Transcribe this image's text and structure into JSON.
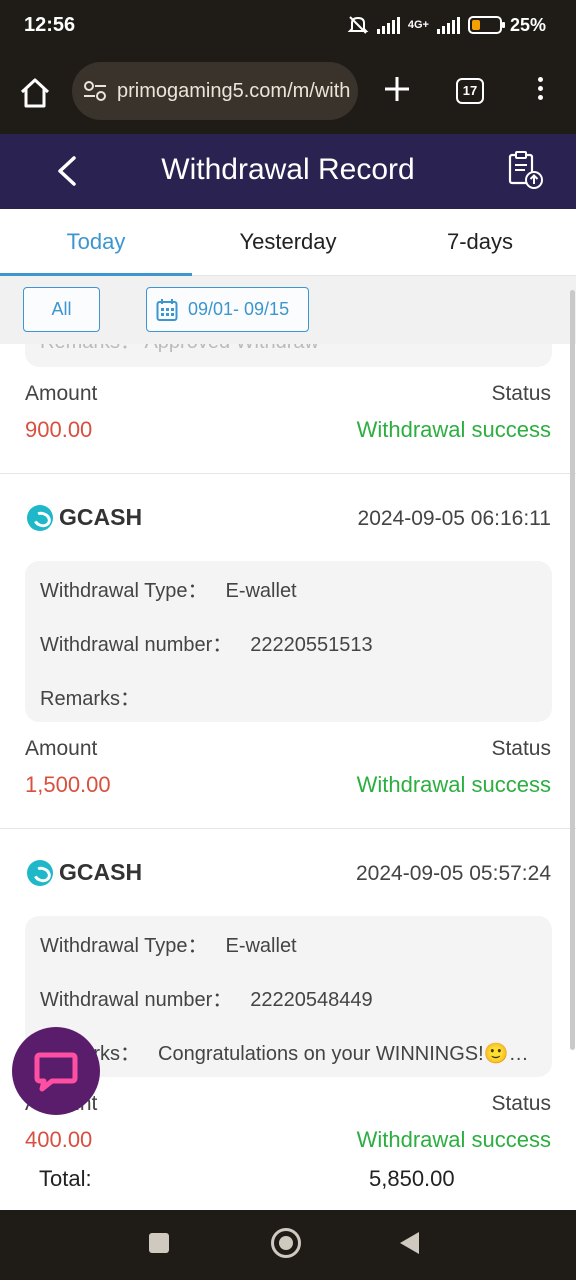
{
  "status_bar": {
    "time": "12:56",
    "network": "4G+",
    "battery": "25%"
  },
  "browser": {
    "url": "primogaming5.com/m/with",
    "tab_count": "17"
  },
  "header": {
    "title": "Withdrawal Record"
  },
  "tabs": [
    {
      "label": "Today",
      "active": true
    },
    {
      "label": "Yesterday",
      "active": false
    },
    {
      "label": "7-days",
      "active": false
    }
  ],
  "filters": {
    "all_label": "All",
    "date_range": "09/01- 09/15"
  },
  "labels": {
    "amount": "Amount",
    "status": "Status",
    "withdrawal_type": "Withdrawal Type：",
    "withdrawal_number": "Withdrawal number：",
    "remarks": "Remarks：",
    "total": "Total:"
  },
  "partial_record": {
    "remarks_line": "Remarks：  Approved Withdraw",
    "amount": "900.00",
    "status": "Withdrawal success"
  },
  "records": [
    {
      "method": "GCASH",
      "datetime": "2024-09-05 06:16:11",
      "withdrawal_type": "E-wallet",
      "withdrawal_number": "22220551513",
      "remarks": "",
      "amount": "1,500.00",
      "status": "Withdrawal success"
    },
    {
      "method": "GCASH",
      "datetime": "2024-09-05 05:57:24",
      "withdrawal_type": "E-wallet",
      "withdrawal_number": "22220548449",
      "remarks": "Congratulations on your WINNINGS!🙂…",
      "amount": "400.00",
      "status": "Withdrawal success"
    }
  ],
  "total": "5,850.00",
  "colors": {
    "header_bg": "#2a2250",
    "accent": "#3d96cf",
    "amount": "#d9503f",
    "success": "#2cae40"
  }
}
